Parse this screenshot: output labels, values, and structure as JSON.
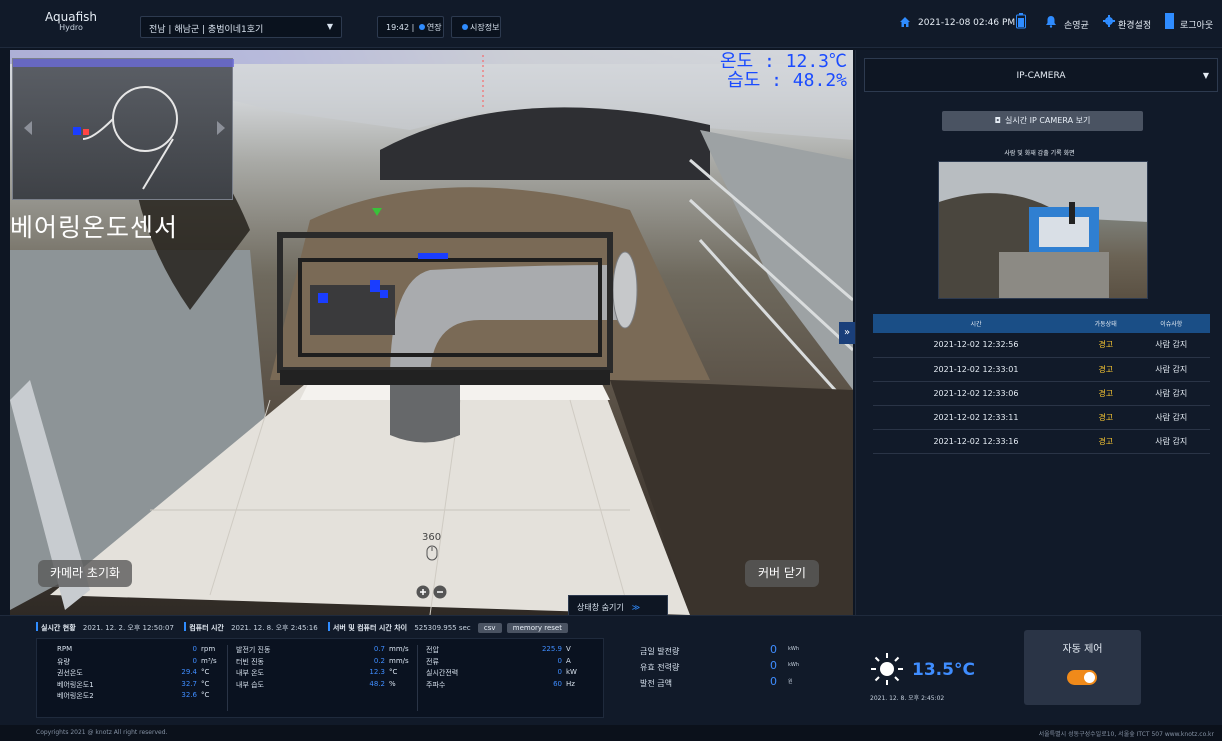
{
  "header": {
    "logo_main": "Aquafish",
    "logo_sub": "Hydro",
    "site_select": "전남 | 해남군 | 충범이네1호기",
    "clock_pill": "19:42 | ",
    "extend_label": "연장",
    "site_info_label": "시장정보",
    "datetime": "2021-12-08 02:46 PM",
    "user": "손영균",
    "settings": "환경설정",
    "logout": "로그아웃"
  },
  "scene": {
    "temperature": "온도 : 12.3℃",
    "humidity": "습도 : 48.2%",
    "sensor_title": "베어링온도센서",
    "rotate_label": "360",
    "camera_reset": "카메라 초기화",
    "cover_close": "커버 닫기",
    "state_toggle": "상태창 숨기기",
    "expand": "»"
  },
  "camera_panel": {
    "select_label": "IP-CAMERA",
    "live_button": "실시간 IP CAMERA 보기",
    "detect_title": "사람 및 화재 감출 기록 화면",
    "columns": [
      "시간",
      "가동상태",
      "이슈사항"
    ],
    "events": [
      {
        "time": "2021-12-02 12:32:56",
        "status": "경고",
        "issue": "사람 감지"
      },
      {
        "time": "2021-12-02 12:33:01",
        "status": "경고",
        "issue": "사람 감지"
      },
      {
        "time": "2021-12-02 12:33:06",
        "status": "경고",
        "issue": "사람 감지"
      },
      {
        "time": "2021-12-02 12:33:11",
        "status": "경고",
        "issue": "사람 감지"
      },
      {
        "time": "2021-12-02 12:33:16",
        "status": "경고",
        "issue": "사람 감지"
      }
    ]
  },
  "status_bar": {
    "realtime_label": "실시간 현황",
    "realtime_value": "2021. 12. 2. 오후 12:50:07",
    "computer_label": "컴퓨터 시간",
    "computer_value": "2021. 12. 8. 오후 2:45:16",
    "diff_label": "서버 및 컴퓨터 시간 차이",
    "diff_value": "525309.955 sec",
    "csv_button": "csv",
    "reset_button": "memory reset"
  },
  "metrics": {
    "col1": [
      {
        "label": "RPM",
        "value": "0",
        "unit": "rpm"
      },
      {
        "label": "유량",
        "value": "0",
        "unit": "m³/s"
      },
      {
        "label": "권선온도",
        "value": "29.4",
        "unit": "°C"
      },
      {
        "label": "베어링온도1",
        "value": "32.7",
        "unit": "°C"
      },
      {
        "label": "베어링온도2",
        "value": "32.6",
        "unit": "°C"
      }
    ],
    "col2": [
      {
        "label": "발전기 진동",
        "value": "0.7",
        "unit": "mm/s"
      },
      {
        "label": "터빈 진동",
        "value": "0.2",
        "unit": "mm/s"
      },
      {
        "label": "내부 온도",
        "value": "12.3",
        "unit": "°C"
      },
      {
        "label": "내부 습도",
        "value": "48.2",
        "unit": "%"
      }
    ],
    "col3": [
      {
        "label": "전압",
        "value": "225.9",
        "unit": "V"
      },
      {
        "label": "전류",
        "value": "0",
        "unit": "A"
      },
      {
        "label": "실시간전력",
        "value": "0",
        "unit": "kW"
      },
      {
        "label": "주파수",
        "value": "60",
        "unit": "Hz"
      }
    ]
  },
  "generation": [
    {
      "label": "금일 발전량",
      "value": "0",
      "unit": "kWh"
    },
    {
      "label": "유효 전력량",
      "value": "0",
      "unit": "kWh"
    },
    {
      "label": "발전 금액",
      "value": "0",
      "unit": "원"
    }
  ],
  "weather": {
    "temperature": "13.5°C",
    "time": "2021. 12. 8. 오후 2:45:02"
  },
  "auto_control": {
    "label": "자동 제어",
    "enabled": true
  },
  "footer": {
    "copyright": "Copyrights 2021 @ knotz All right reserved.",
    "address": "서울특별시 성동구성수일로10, 서울숲 ITCT 507 www.knotz.co.kr"
  },
  "colors": {
    "accent": "#2f8cff",
    "warn": "#ffcc33",
    "toggle": "#f08a1a",
    "header_bg": "#111a29"
  }
}
